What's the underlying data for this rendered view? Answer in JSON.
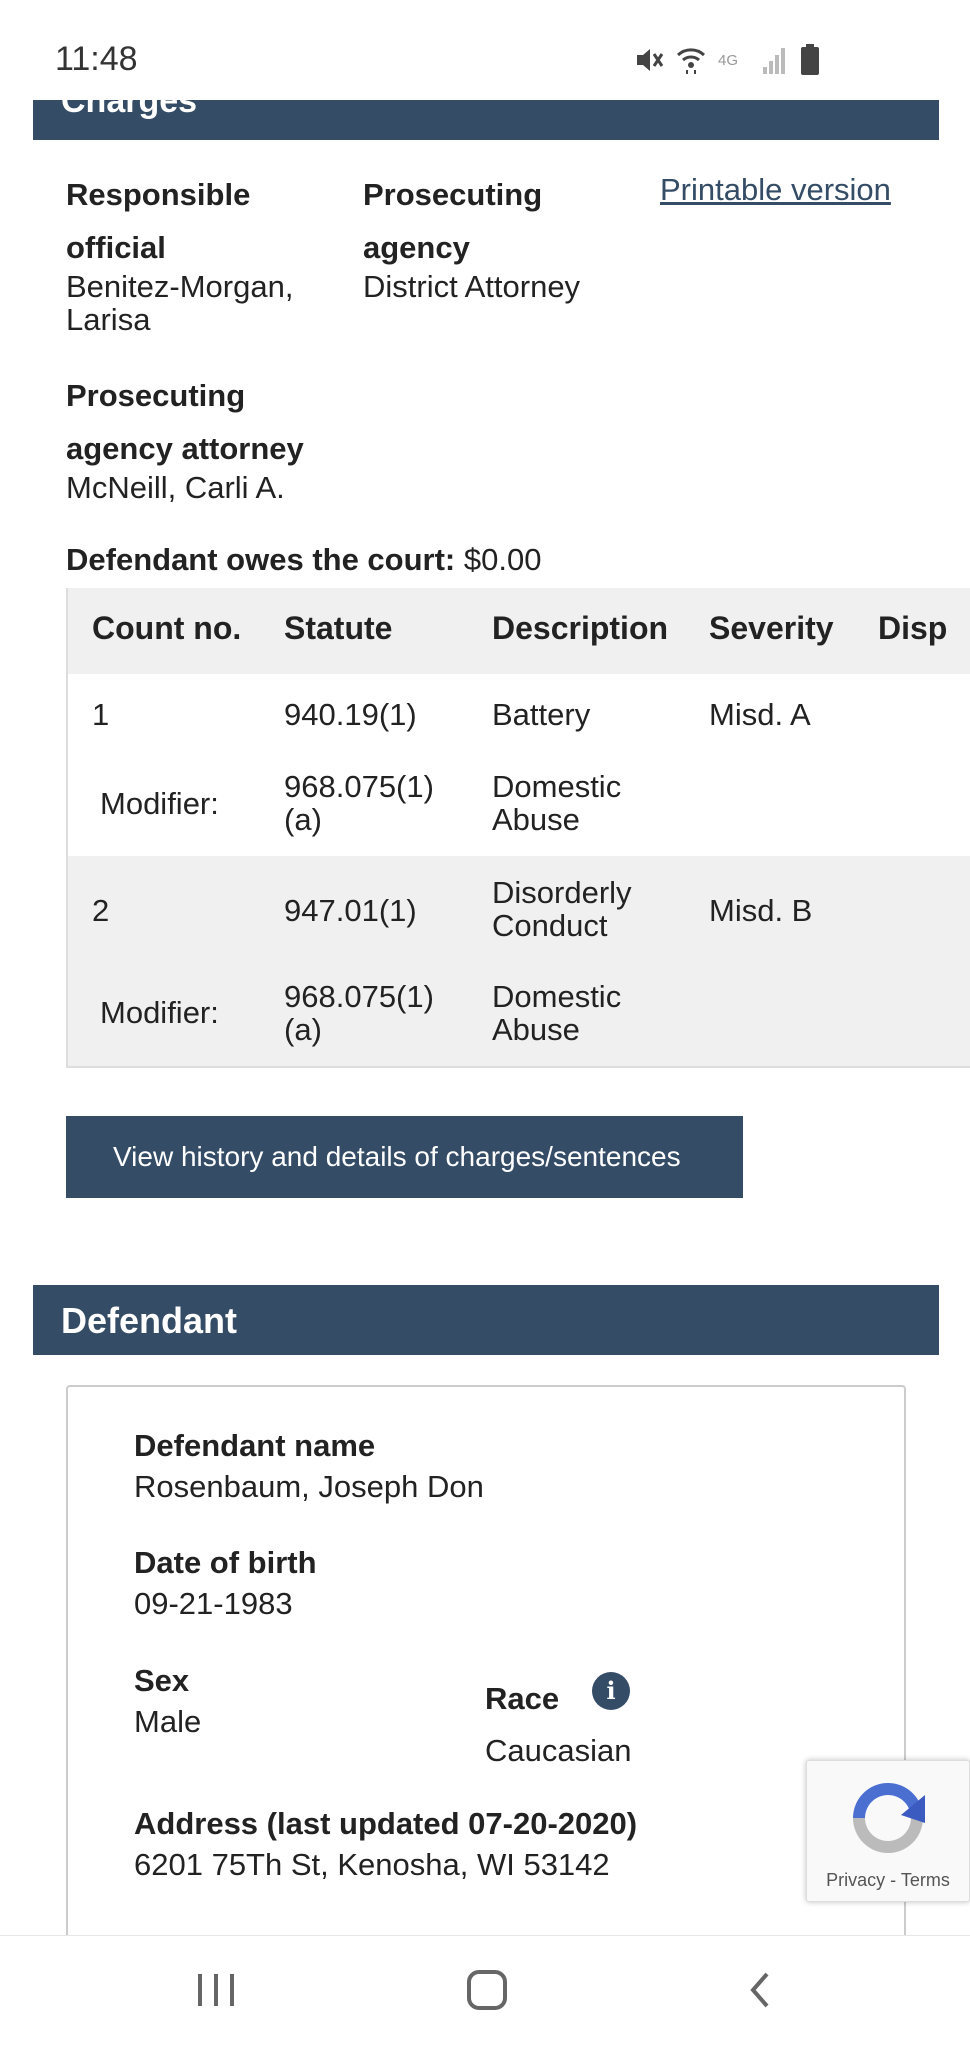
{
  "status_bar": {
    "time": "11:48",
    "icons": [
      "mute-icon",
      "wifi-icon",
      "4g-icon",
      "signal-icon",
      "battery-icon"
    ]
  },
  "charges": {
    "section_title": "Charges",
    "responsible_official_label": "Responsible official",
    "responsible_official_value": "Benitez-Morgan, Larisa",
    "prosecuting_agency_label": "Prosecuting agency",
    "prosecuting_agency_value": "District Attorney",
    "printable_link": "Printable version",
    "prosecuting_attorney_label": "Prosecuting agency attorney",
    "prosecuting_attorney_value": "McNeill, Carli A.",
    "owes_label": "Defendant owes the court:",
    "owes_value": "$0.00",
    "table": {
      "headers": [
        "Count no.",
        "Statute",
        "Description",
        "Severity",
        "Disp"
      ],
      "rows": [
        {
          "count": "1",
          "statute": "940.19(1)",
          "description": "Battery",
          "severity": "Misd. A",
          "modifier_label": "Modifier:",
          "modifier_statute": "968.075(1)(a)",
          "modifier_description": "Domestic Abuse"
        },
        {
          "count": "2",
          "statute": "947.01(1)",
          "description": "Disorderly Conduct",
          "severity": "Misd. B",
          "modifier_label": "Modifier:",
          "modifier_statute": "968.075(1)(a)",
          "modifier_description": "Domestic Abuse"
        }
      ]
    },
    "view_history_button": "View history and details of charges/sentences"
  },
  "defendant": {
    "section_title": "Defendant",
    "name_label": "Defendant name",
    "name_value": "Rosenbaum, Joseph Don",
    "dob_label": "Date of birth",
    "dob_value": "09-21-1983",
    "sex_label": "Sex",
    "sex_value": "Male",
    "race_label": "Race",
    "race_value": "Caucasian",
    "address_label": "Address (last updated 07-20-2020)",
    "address_value": "6201 75Th St, Kenosha, WI 53142"
  },
  "recaptcha": {
    "privacy": "Privacy",
    "separator": "-",
    "terms": "Terms"
  },
  "nav_bar": {
    "buttons": [
      "recent-apps-icon",
      "home-icon",
      "back-icon"
    ]
  },
  "colors": {
    "header_bg": "#344c66",
    "table_head_bg": "#f0f0f0",
    "row_alt_bg": "#f0f0f0"
  }
}
